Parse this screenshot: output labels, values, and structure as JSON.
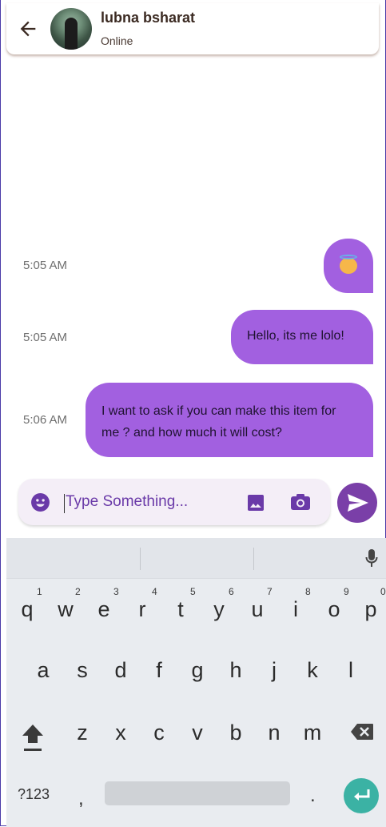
{
  "header": {
    "contact_name": "lubna bsharat",
    "status": "Online"
  },
  "messages": [
    {
      "time": "5:05 AM",
      "text": "",
      "kind": "emoji",
      "emoji": "smiling-face-with-halo"
    },
    {
      "time": "5:05 AM",
      "text": "Hello, its me lolo!",
      "kind": "text"
    },
    {
      "time": "5:06 AM",
      "text": "I want to ask if you can make this item for me ? and how much it will cost?",
      "kind": "text"
    }
  ],
  "composer": {
    "placeholder": "Type Something..."
  },
  "keyboard": {
    "row1": [
      "q",
      "w",
      "e",
      "r",
      "t",
      "y",
      "u",
      "i",
      "o",
      "p"
    ],
    "row1_numbers": [
      "1",
      "2",
      "3",
      "4",
      "5",
      "6",
      "7",
      "8",
      "9",
      "0"
    ],
    "row2": [
      "a",
      "s",
      "d",
      "f",
      "g",
      "h",
      "j",
      "k",
      "l"
    ],
    "row3": [
      "z",
      "x",
      "c",
      "v",
      "b",
      "n",
      "m"
    ],
    "symbols_key": "?123",
    "comma": ",",
    "period": "."
  },
  "colors": {
    "bubble": "#a260e0",
    "send_button": "#7a3fa8",
    "enter_key": "#3bb2a4"
  }
}
